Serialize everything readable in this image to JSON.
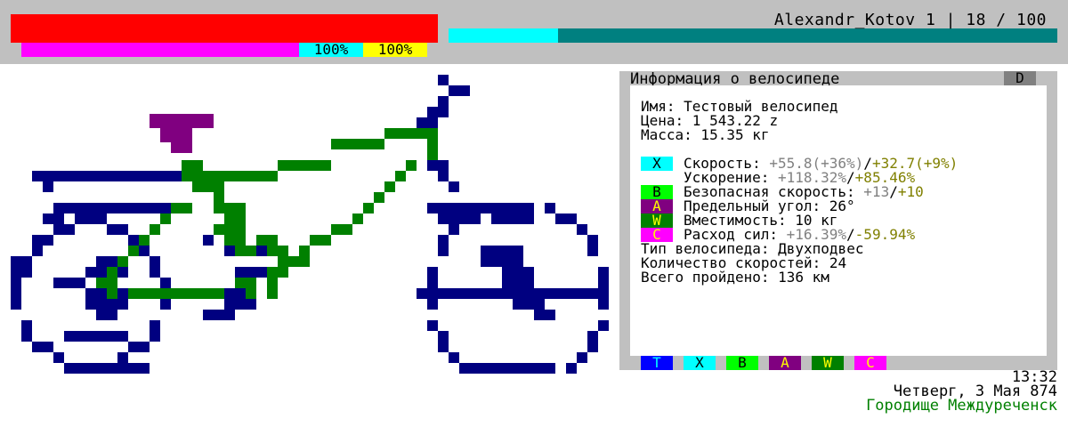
{
  "hud": {
    "player_line": "Alexandr_Kotov 1 | 18 / 100",
    "health_percent": 100,
    "energy_label": "100%",
    "stamina_label": "100%",
    "experience_fraction": 0.18,
    "colors": {
      "health": "#ff0000",
      "energy": "#ff00ff",
      "stamina": "#ffff00",
      "energy_bg": "#00ffff",
      "xp_fill": "#00ffff",
      "xp_bg": "#008080"
    }
  },
  "panel": {
    "title": "Информация о велосипеде",
    "close_key": "D",
    "name_line": "Имя: Тестовый велосипед",
    "price_line": "Цена: 1 543.22 z",
    "mass_line": "Масса: 15.35 кг",
    "stats": [
      {
        "tag": "X",
        "tag_bg": "#00ffff",
        "tag_fg": "#000000",
        "label": "Скорость: ",
        "base": "+55.8(+36%)",
        "sep": "/",
        "bonus": "+32.7(+9%)"
      },
      {
        "tag": "",
        "tag_bg": "",
        "tag_fg": "",
        "label": "Ускорение: ",
        "base": "+118.32%",
        "sep": "/",
        "bonus": "+85.46%"
      },
      {
        "tag": "B",
        "tag_bg": "#00ff00",
        "tag_fg": "#000000",
        "label": "Безопасная скорость: ",
        "base": "+13",
        "sep": "/",
        "bonus": "+10"
      },
      {
        "tag": "A",
        "tag_bg": "#800080",
        "tag_fg": "#ffff00",
        "label": "Предельный угол: 26°",
        "base": "",
        "sep": "",
        "bonus": ""
      },
      {
        "tag": "W",
        "tag_bg": "#008000",
        "tag_fg": "#ffff00",
        "label": "Вместимость: 10 кг",
        "base": "",
        "sep": "",
        "bonus": ""
      },
      {
        "tag": "C",
        "tag_bg": "#ff00ff",
        "tag_fg": "#ffff00",
        "label": "Расход сил: ",
        "base": "+16.39%",
        "sep": "/",
        "bonus": "-59.94%"
      }
    ],
    "type_line": "Тип велосипеда: Двухподвес",
    "gears_line": "Количество скоростей: 24",
    "distance_line": "Всего пройдено: 136 км",
    "tabs": [
      {
        "key": "T",
        "bg": "#0000ff",
        "fg": "#00ffff"
      },
      {
        "key": "X",
        "bg": "#00ffff",
        "fg": "#000000"
      },
      {
        "key": "B",
        "bg": "#00ff00",
        "fg": "#000000"
      },
      {
        "key": "A",
        "bg": "#800080",
        "fg": "#ffff00"
      },
      {
        "key": "W",
        "bg": "#008000",
        "fg": "#ffff00"
      },
      {
        "key": "C",
        "bg": "#ff00ff",
        "fg": "#ffff00"
      }
    ]
  },
  "status": {
    "time": "13:32",
    "date": "Четверг, 3 Мая 874",
    "location": "Городище Междуреченск",
    "location_color": "#008000"
  },
  "bike_colors": {
    "frame": "#000080",
    "fork": "#008000",
    "seat": "#800080"
  }
}
